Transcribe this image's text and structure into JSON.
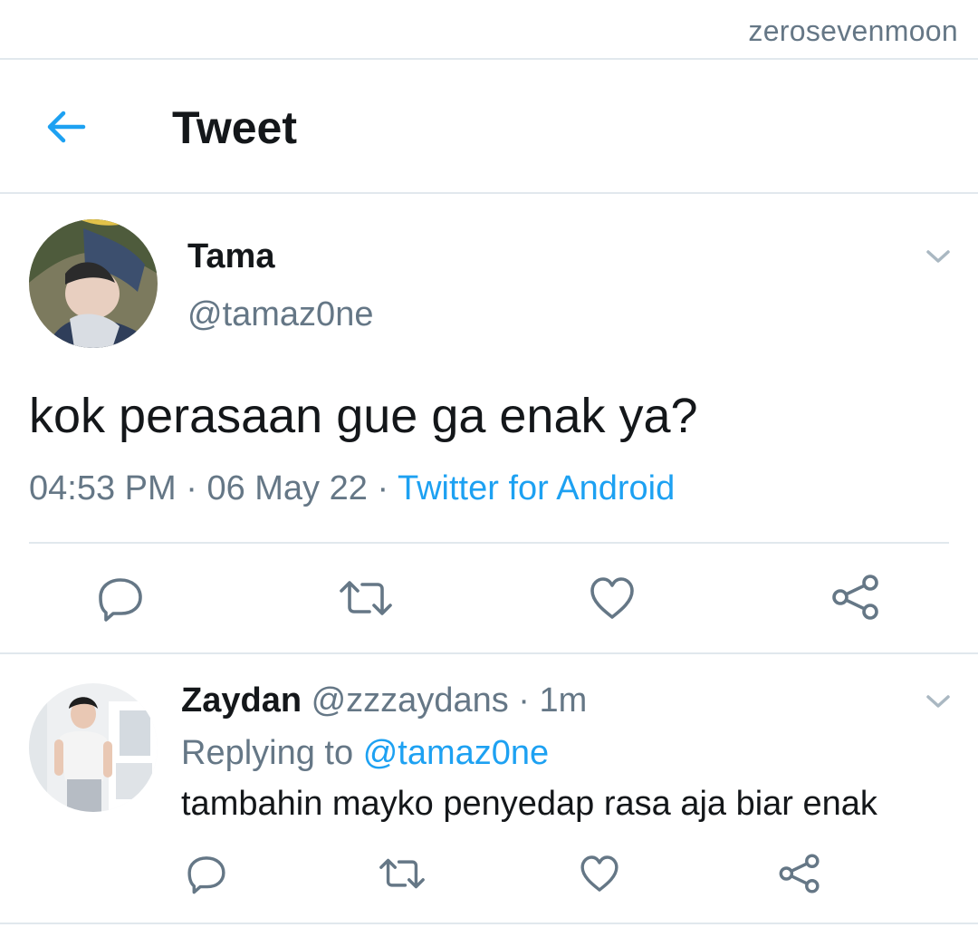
{
  "watermark": "zerosevenmoon",
  "header": {
    "title": "Tweet"
  },
  "tweet": {
    "author_name": "Tama",
    "author_handle": "@tamaz0ne",
    "text": "kok perasaan gue ga enak ya?",
    "time": "04:53 PM",
    "date": "06 May 22",
    "separator": "·",
    "source": "Twitter for Android",
    "actions": [
      "reply-icon",
      "retweet-icon",
      "like-icon",
      "share-icon"
    ]
  },
  "reply": {
    "author_name": "Zaydan",
    "author_handle": "@zzzaydans",
    "separator": "·",
    "time_ago": "1m",
    "replying_label": "Replying to",
    "replying_to": "@tamaz0ne",
    "text": "tambahin mayko penyedap rasa aja biar enak",
    "actions": [
      "reply-icon",
      "retweet-icon",
      "like-icon",
      "share-icon"
    ]
  },
  "colors": {
    "accent": "#1da1f2",
    "text": "#14171a",
    "secondary": "#657786",
    "divider": "#e1e8ed"
  }
}
